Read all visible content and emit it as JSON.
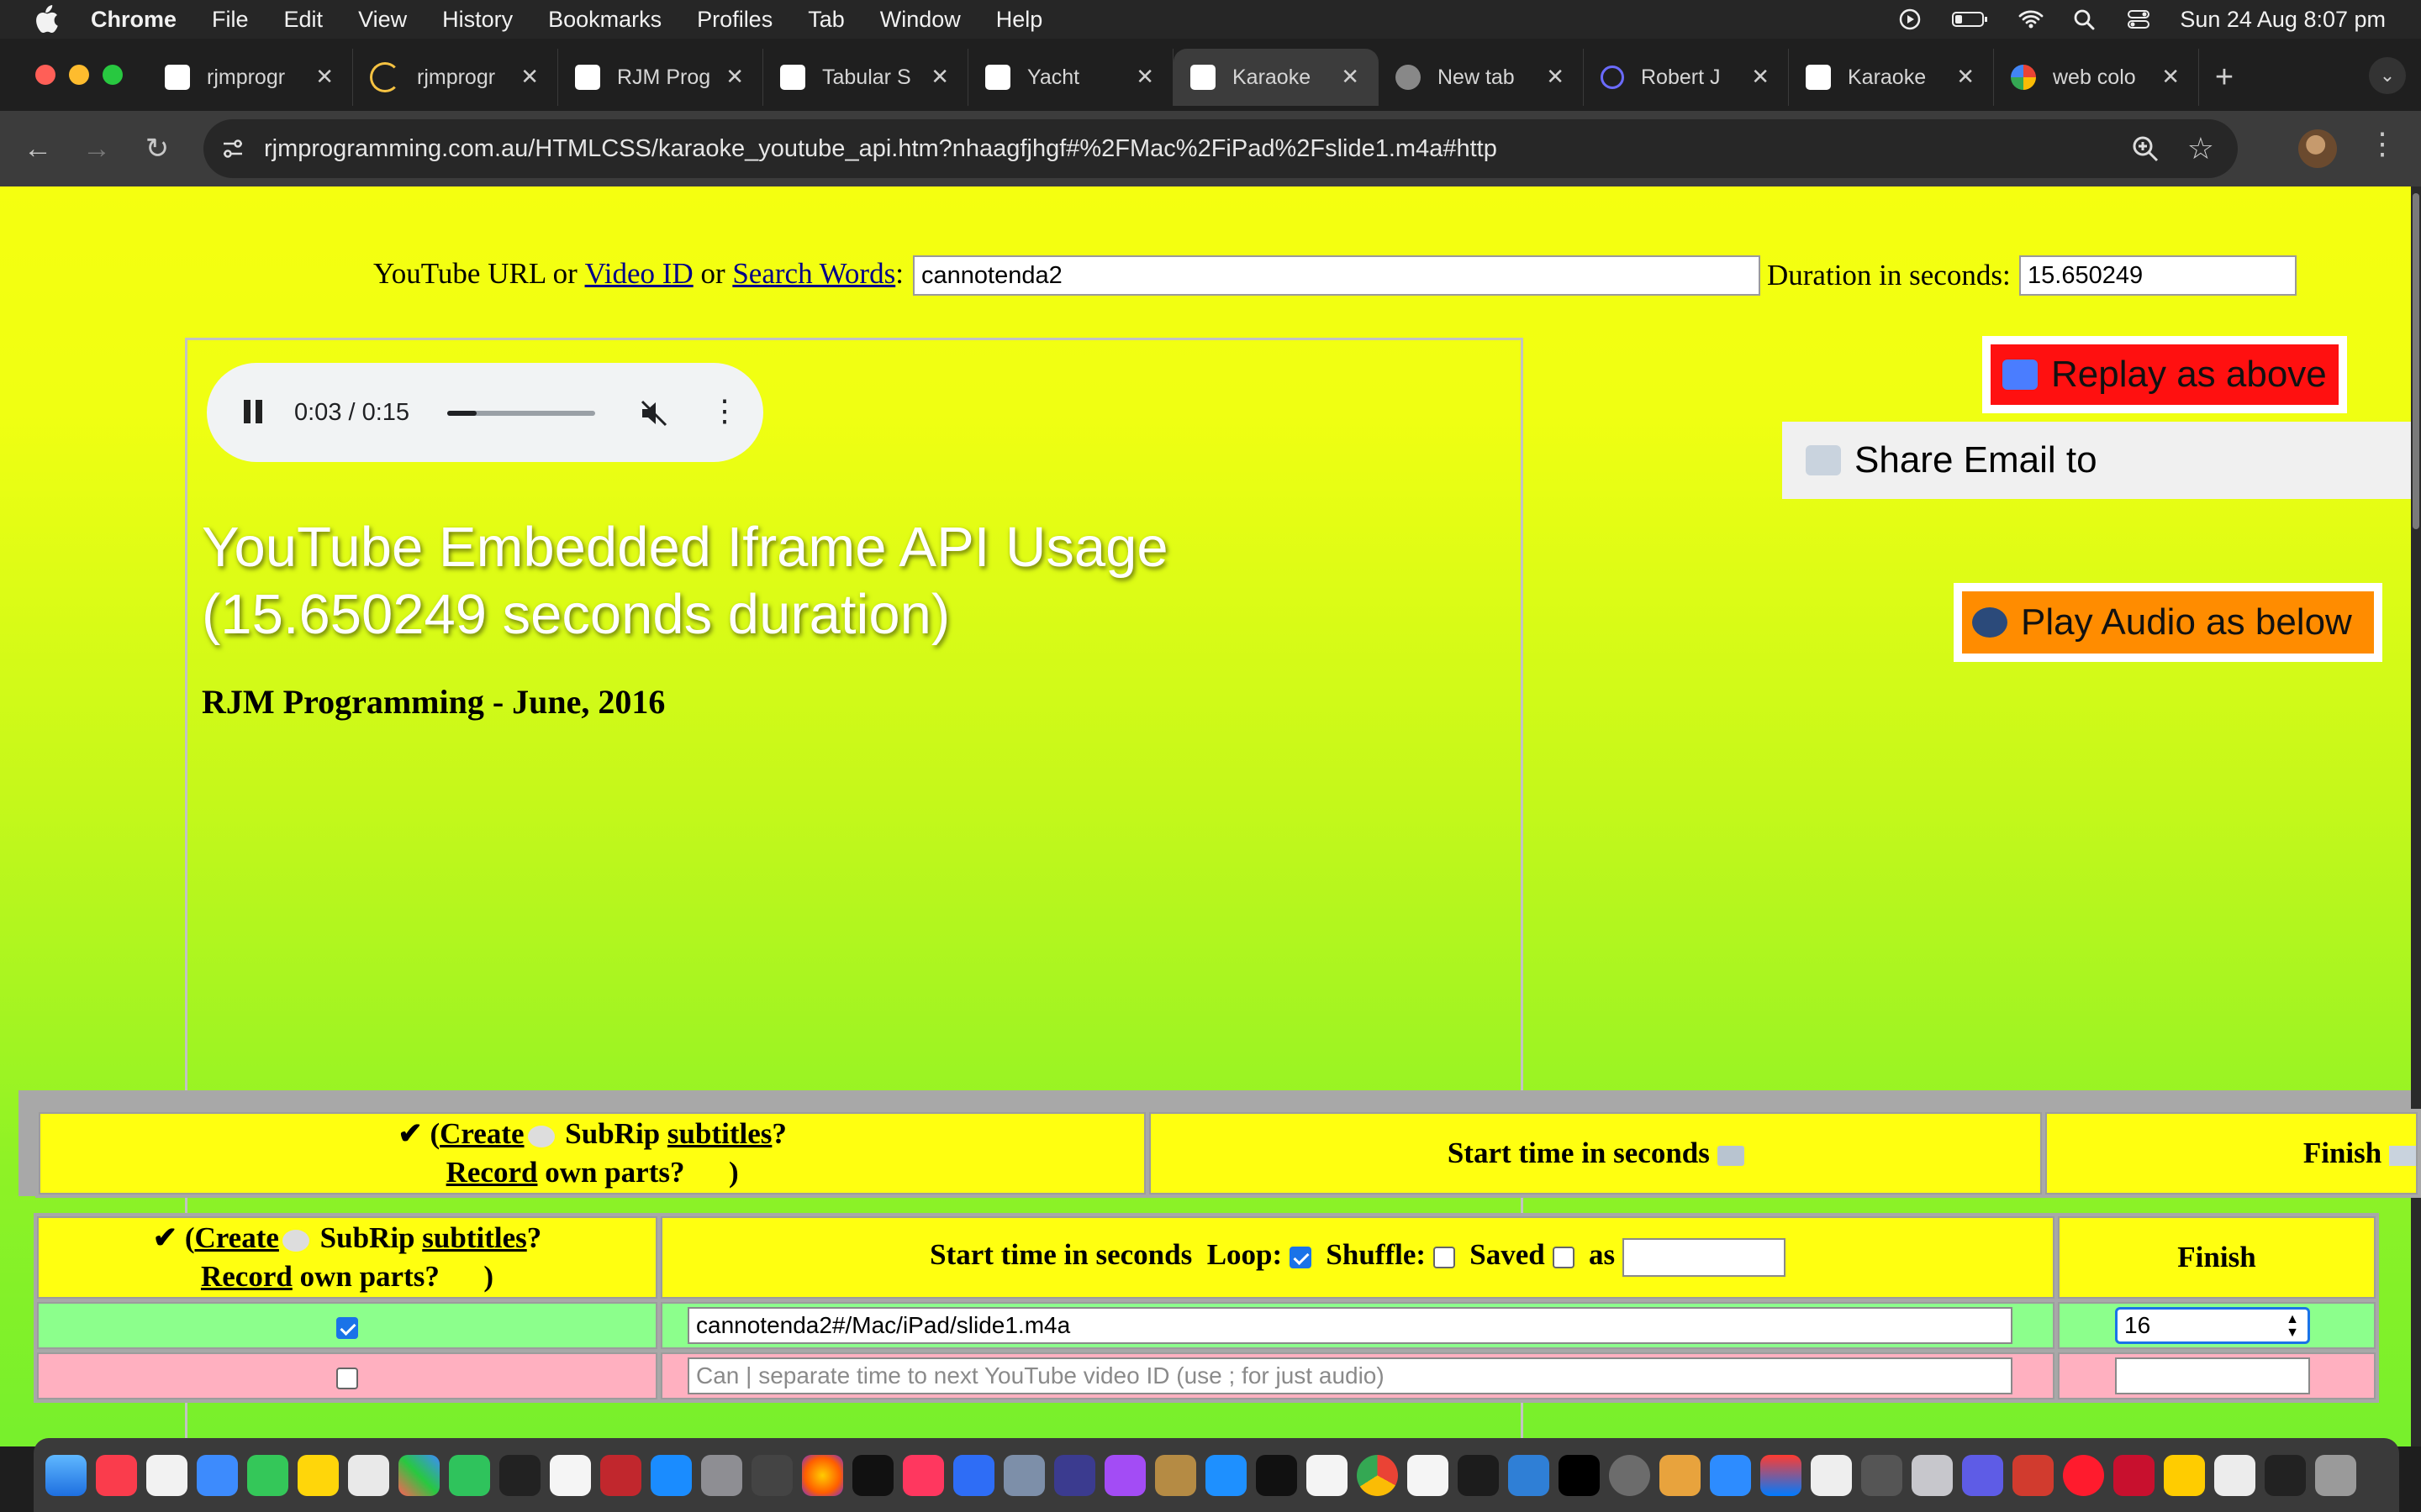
{
  "menubar": {
    "app": "Chrome",
    "items": [
      "File",
      "Edit",
      "View",
      "History",
      "Bookmarks",
      "Profiles",
      "Tab",
      "Window",
      "Help"
    ],
    "datetime": "Sun 24 Aug  8:07 pm"
  },
  "tabs": [
    {
      "title": "rjmprogr",
      "active": false
    },
    {
      "title": "rjmprogr",
      "active": false
    },
    {
      "title": "RJM Prog",
      "active": false
    },
    {
      "title": "Tabular S",
      "active": false
    },
    {
      "title": "Yacht",
      "active": false
    },
    {
      "title": "Karaoke",
      "active": true
    },
    {
      "title": "New tab",
      "active": false
    },
    {
      "title": "Robert J",
      "active": false
    },
    {
      "title": "Karaoke",
      "active": false
    },
    {
      "title": "web colo",
      "active": false
    }
  ],
  "omnibox": {
    "url": "rjmprogramming.com.au/HTMLCSS/karaoke_youtube_api.htm?nhaagfjhgf#%2FMac%2FiPad%2Fslide1.m4a#http"
  },
  "form": {
    "label_prefix": "YouTube URL or ",
    "video_id_link": "Video ID",
    "or": " or ",
    "search_link": "Search Words",
    "colon": ":",
    "url_value": "cannotenda2",
    "duration_label": "Duration in seconds:",
    "duration_value": "15.650249"
  },
  "audio": {
    "time": "0:03 / 0:15",
    "progress_fraction": 0.2
  },
  "player": {
    "title": "YouTube Embedded Iframe API Usage (15.650249 seconds duration)",
    "byline": "RJM Programming - June, 2016"
  },
  "buttons": {
    "replay": "Replay as above",
    "share": "Share Email to",
    "play_audio": "Play Audio as below"
  },
  "sticky_header": {
    "col1_pre": "✔ (",
    "create": "Create",
    "subrip": " SubRip ",
    "subtitles": "subtitles",
    "q": "?",
    "record": "Record",
    "own_parts": " own parts?      )",
    "col2": "Start time in seconds",
    "col3": "Finish"
  },
  "table": {
    "header": {
      "col2": "Start time in seconds",
      "loop": "Loop:",
      "shuffle": "Shuffle:",
      "saved": "Saved",
      "as": "as",
      "col3": "Finish"
    },
    "rows": [
      {
        "checked": true,
        "start_value": "cannotenda2#/Mac/iPad/slide1.m4a",
        "start_placeholder": "",
        "finish": "16"
      },
      {
        "checked": false,
        "start_value": "",
        "start_placeholder": "Can | separate time to next YouTube video ID (use ; for just audio)",
        "finish": ""
      }
    ]
  },
  "colors": {
    "page_top": "#f5ff10",
    "page_bottom": "#77f02c",
    "replay_bg": "#ff1010",
    "play_audio_bg": "#ff8c00",
    "row_checked": "#8cff8c",
    "row_unchecked": "#ffb0c0",
    "header_cell": "#ffff10"
  }
}
